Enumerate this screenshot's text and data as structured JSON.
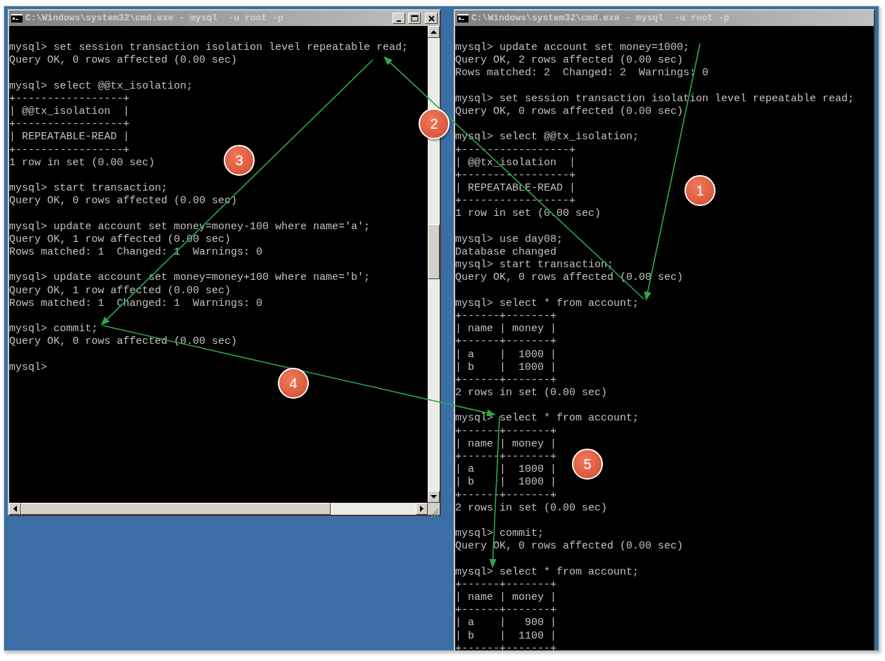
{
  "windows": [
    {
      "title": "C:\\Windows\\system32\\cmd.exe - mysql  -u root -p",
      "active": false,
      "blocks": [
        [
          "mysql> set session transaction isolation level repeatable read;",
          "Query OK, 0 rows affected (0.00 sec)"
        ],
        [
          "mysql> select @@tx_isolation;",
          "+-----------------+",
          "| @@tx_isolation  |",
          "+-----------------+",
          "| REPEATABLE-READ |",
          "+-----------------+",
          "1 row in set (0.00 sec)"
        ],
        [
          "mysql> start transaction;",
          "Query OK, 0 rows affected (0.00 sec)"
        ],
        [
          "mysql> update account set money=money-100 where name='a';",
          "Query OK, 1 row affected (0.00 sec)",
          "Rows matched: 1  Changed: 1  Warnings: 0"
        ],
        [
          "mysql> update account set money=money+100 where name='b';",
          "Query OK, 1 row affected (0.00 sec)",
          "Rows matched: 1  Changed: 1  Warnings: 0"
        ],
        [
          "mysql> commit;",
          "Query OK, 0 rows affected (0.00 sec)"
        ],
        [
          "mysql>"
        ]
      ]
    },
    {
      "title": "C:\\Windows\\system32\\cmd.exe - mysql  -u root -p",
      "active": false,
      "blocks": [
        [
          "mysql> update account set money=1000;",
          "Query OK, 2 rows affected (0.00 sec)",
          "Rows matched: 2  Changed: 2  Warnings: 0"
        ],
        [
          "mysql> set session transaction isolation level repeatable read;",
          "Query OK, 0 rows affected (0.00 sec)"
        ],
        [
          "mysql> select @@tx_isolation;",
          "+-----------------+",
          "| @@tx_isolation  |",
          "+-----------------+",
          "| REPEATABLE-READ |",
          "+-----------------+",
          "1 row in set (0.00 sec)"
        ],
        [
          "mysql> use day08;",
          "Database changed",
          "mysql> start transaction;",
          "Query OK, 0 rows affected (0.00 sec)"
        ],
        [
          "mysql> select * from account;",
          "+------+-------+",
          "| name | money |",
          "+------+-------+",
          "| a    |  1000 |",
          "| b    |  1000 |",
          "+------+-------+",
          "2 rows in set (0.00 sec)"
        ],
        [
          "mysql> select * from account;",
          "+------+-------+",
          "| name | money |",
          "+------+-------+",
          "| a    |  1000 |",
          "| b    |  1000 |",
          "+------+-------+",
          "2 rows in set (0.00 sec)"
        ],
        [
          "mysql> commit;",
          "Query OK, 0 rows affected (0.00 sec)"
        ],
        [
          "mysql> select * from account;",
          "+------+-------+",
          "| name | money |",
          "+------+-------+",
          "| a    |   900 |",
          "| b    |  1100 |",
          "+------+-------+"
        ]
      ]
    }
  ],
  "annotations": [
    {
      "label": "1"
    },
    {
      "label": "2"
    },
    {
      "label": "3"
    },
    {
      "label": "4"
    },
    {
      "label": "5"
    }
  ]
}
